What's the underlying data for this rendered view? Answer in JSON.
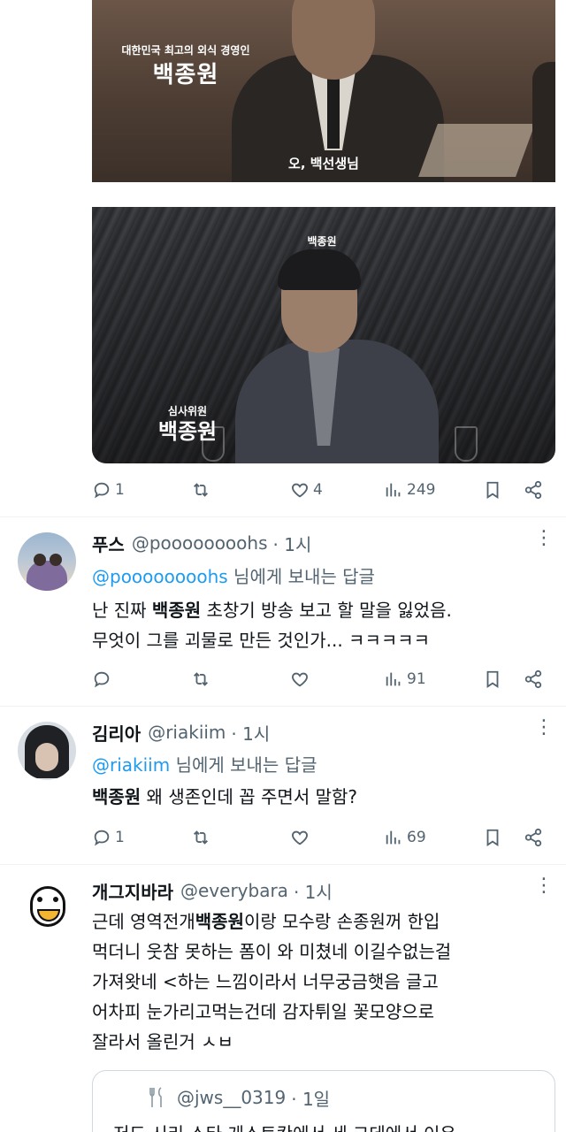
{
  "media": {
    "image1": {
      "caption_small": "대한민국 최고의 외식 경영인",
      "caption_big": "백종원",
      "subtitle": "오, 백선생님"
    },
    "image2": {
      "caption_top": "백종원",
      "caption_small": "심사위원",
      "caption_big": "백종원"
    }
  },
  "main_post_actions": {
    "replies": "1",
    "reposts": "",
    "likes": "4",
    "views": "249"
  },
  "replies": [
    {
      "name": "푸스",
      "handle": "@poooooooohs",
      "time": "· 1시",
      "reply_mention": "@poooooooohs",
      "reply_suffix": " 님에게 보내는 답글",
      "text_line1_pre": "난 진짜 ",
      "text_line1_bold": "백종원",
      "text_line1_post": " 초창기 방송 보고 할 말을 잃었음.",
      "text_line2": "무엇이 그를 괴물로 만든 것인가... ㅋㅋㅋㅋㅋ",
      "actions": {
        "replies": "",
        "reposts": "",
        "likes": "",
        "views": "91"
      }
    },
    {
      "name": "김리아",
      "handle": "@riakiim",
      "time": "· 1시",
      "reply_mention": "@riakiim",
      "reply_suffix": " 님에게 보내는 답글",
      "text_bold": "백종원",
      "text_rest": " 왜 생존인데 꼽 주면서 말함?",
      "actions": {
        "replies": "1",
        "reposts": "",
        "likes": "",
        "views": "69"
      }
    },
    {
      "name": "개그지바라",
      "handle": "@everybara",
      "time": "· 1시",
      "line1_pre": "근데 영역전개",
      "line1_bold": "백종원",
      "line1_post": "이랑 모수랑 손종원꺼 한입",
      "line2": "먹더니 웃참 못하는 폼이 와 미쳤네 이길수없는걸",
      "line3": "가져왓네 <하는 느낌이라서 너무궁금햇음 글고",
      "line4": "어차피 눈가리고먹는건데 감자튀일 꽃모양으로",
      "line5": "잘라서 올린거 ㅅㅂ"
    }
  ],
  "quote": {
    "handle": "@jws__0319",
    "time": "· 1일",
    "text": "저도 시리 스타 게스트칸에서 세 그데에서 이유"
  },
  "icons": {
    "reply": "reply-icon",
    "repost": "repost-icon",
    "like": "heart-icon",
    "views": "views-icon",
    "bookmark": "bookmark-icon",
    "share": "share-icon",
    "more": "more-icon",
    "fork_knife": "fork-knife-icon"
  },
  "colors": {
    "link": "#1d9bf0",
    "secondary": "#536471",
    "text": "#0f1419",
    "divider": "#eff3f4"
  }
}
